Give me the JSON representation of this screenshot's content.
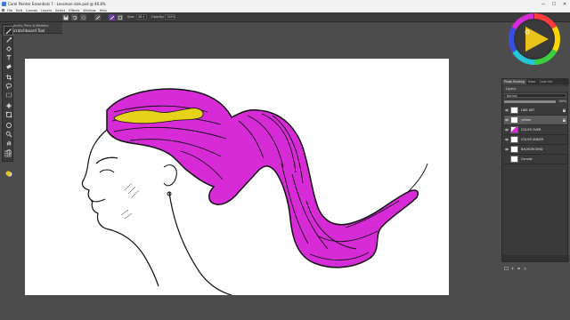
{
  "window": {
    "title": "Corel Painter Essentials 7 - Lessman-side.psd @ 46.8%",
    "controls": [
      "—",
      "☐",
      "✕"
    ]
  },
  "menu": {
    "items": [
      "File",
      "Edit",
      "Canvas",
      "Layers",
      "Select",
      "Effects",
      "Window",
      "Help"
    ]
  },
  "propertybar": {
    "size_label": "Size:",
    "size_value": "46.4",
    "opacity_label": "Opacity:",
    "opacity_value": "100%"
  },
  "brush": {
    "category": "Pencils, Pens & Markers",
    "variant": "Scratchboard Tool"
  },
  "tools": [
    "brush-icon",
    "dropper-icon",
    "paint-bucket-icon",
    "text-icon",
    "eraser-icon",
    "crop-icon",
    "lasso-icon",
    "rect-select-icon",
    "move-icon",
    "transform-icon",
    "shape-icon",
    "magnifier-icon",
    "hand-icon",
    "rotate-icon",
    "ellipse-icon",
    "grid-icon"
  ],
  "colors": {
    "accent": "#d62bd6",
    "hair_highlight": "#e6d21a",
    "panel_bg": "#3a3a3a",
    "workspace_bg": "#4c4c4c",
    "main_color": "#e8c21a",
    "secondary_color": "#d8d8d8"
  },
  "layers_panel": {
    "tabs": [
      "Photo Painting",
      "Mixer",
      "Color Set"
    ],
    "title": "Layers",
    "blend_mode": "Normal",
    "opacity": "100%",
    "opacity_fraction": 1.0,
    "layers": [
      {
        "name": "LINE ART",
        "selected": false,
        "locked": true
      },
      {
        "name": "yellow",
        "selected": true,
        "locked": true
      },
      {
        "name": "COLOR OVER",
        "selected": false,
        "locked": false
      },
      {
        "name": "COLOR UNDER",
        "selected": false,
        "locked": false
      },
      {
        "name": "BACKGROUND",
        "selected": false,
        "locked": false
      },
      {
        "name": "Canvas",
        "selected": false,
        "locked": false
      }
    ]
  }
}
